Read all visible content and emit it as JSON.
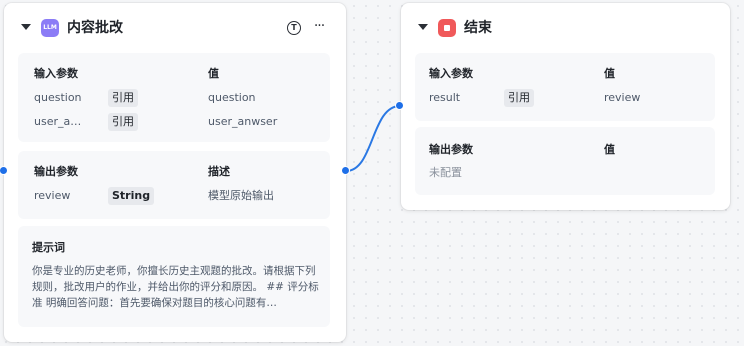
{
  "colors": {
    "edge": "#2a78e4",
    "llm_badge": "#8b7cf6",
    "end_badge": "#f0595a"
  },
  "llm_node": {
    "badge": "LLM",
    "title": "内容批改",
    "t_icon": "T",
    "more_icon": "···",
    "input": {
      "headers": [
        "输入参数",
        "值"
      ],
      "rows": [
        {
          "name": "question",
          "type": "引用",
          "value": "question"
        },
        {
          "name": "user_a…",
          "type": "引用",
          "value": "user_anwser"
        }
      ]
    },
    "output": {
      "headers": [
        "输出参数",
        "描述"
      ],
      "rows": [
        {
          "name": "review",
          "type": "String",
          "desc": "模型原始输出"
        }
      ]
    },
    "prompt": {
      "title": "提示词",
      "text": "你是专业的历史老师，你擅长历史主观题的批改。请根据下列规则，批改用户的作业，并给出你的评分和原因。 ## 评分标准 明确回答问题：首先要确保对题目的核心问题有…"
    }
  },
  "end_node": {
    "title": "结束",
    "input": {
      "headers": [
        "输入参数",
        "值"
      ],
      "rows": [
        {
          "name": "result",
          "type": "引用",
          "value": "review"
        }
      ]
    },
    "output": {
      "headers": [
        "输出参数",
        "值"
      ],
      "empty_text": "未配置"
    }
  }
}
